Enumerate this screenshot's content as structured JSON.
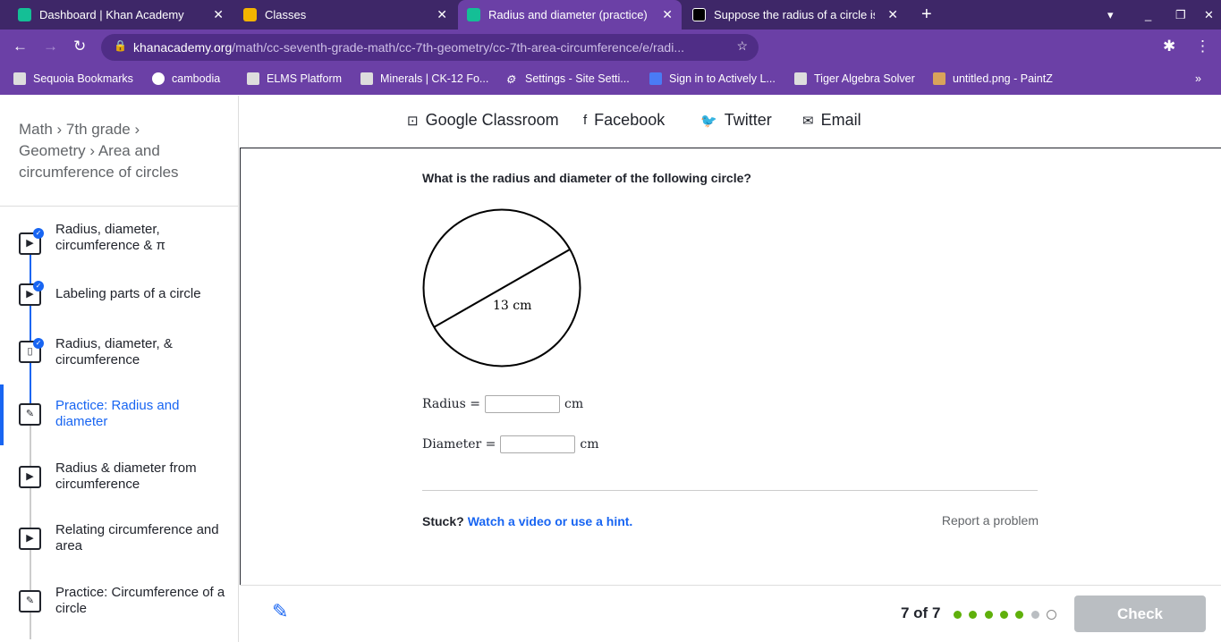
{
  "tabs": [
    {
      "title": "Dashboard | Khan Academy",
      "active": false
    },
    {
      "title": "Classes",
      "active": false
    },
    {
      "title": "Radius and diameter (practice) | Khan Academy",
      "active": true
    },
    {
      "title": "Suppose the radius of a circle is",
      "active": false
    }
  ],
  "url": {
    "domain": "khanacademy.org",
    "path": "/math/cc-seventh-grade-math/cc-7th-geometry/cc-7th-area-circumference/e/radi..."
  },
  "bookmarks": [
    "Sequoia Bookmarks",
    "cambodia",
    "ELMS Platform",
    "Minerals | CK-12 Fo...",
    "Settings - Site Setti...",
    "Sign in to Actively L...",
    "Tiger Algebra Solver",
    "untitled.png - PaintZ"
  ],
  "breadcrumb": {
    "math": "Math",
    "grade": "7th grade",
    "geometry": "Geometry",
    "unit": "Area and circumference of circles"
  },
  "sidebar": {
    "items": [
      {
        "label": "Radius, diameter, circumference & π",
        "type": "video",
        "done": true
      },
      {
        "label": "Labeling parts of a circle",
        "type": "video",
        "done": true
      },
      {
        "label": "Radius, diameter, & circumference",
        "type": "article",
        "done": true
      },
      {
        "label": "Practice: Radius and diameter",
        "type": "practice",
        "current": true
      },
      {
        "label": "Radius & diameter from circumference",
        "type": "video"
      },
      {
        "label": "Relating circumference and area",
        "type": "video"
      },
      {
        "label": "Practice: Circumference of a circle",
        "type": "practice"
      }
    ]
  },
  "share": {
    "classroom": "Google Classroom",
    "facebook": "Facebook",
    "twitter": "Twitter",
    "email": "Email"
  },
  "question": {
    "prompt": "What is the radius and diameter of the following circle?",
    "figure_label": "13 cm",
    "radius_label": "Radius =",
    "diameter_label": "Diameter =",
    "unit": "cm",
    "radius_value": "",
    "diameter_value": ""
  },
  "help": {
    "stuck": "Stuck?",
    "hint": "Watch a video or use a hint.",
    "report": "Report a problem"
  },
  "footer": {
    "count": "7 of 7",
    "progress": [
      "correct",
      "correct",
      "correct",
      "correct",
      "correct",
      "skipped",
      "current"
    ],
    "check": "Check"
  },
  "colors": {
    "accent": "#1865f2",
    "correct": "#5fb00b",
    "chrome": "#6b40a6"
  }
}
